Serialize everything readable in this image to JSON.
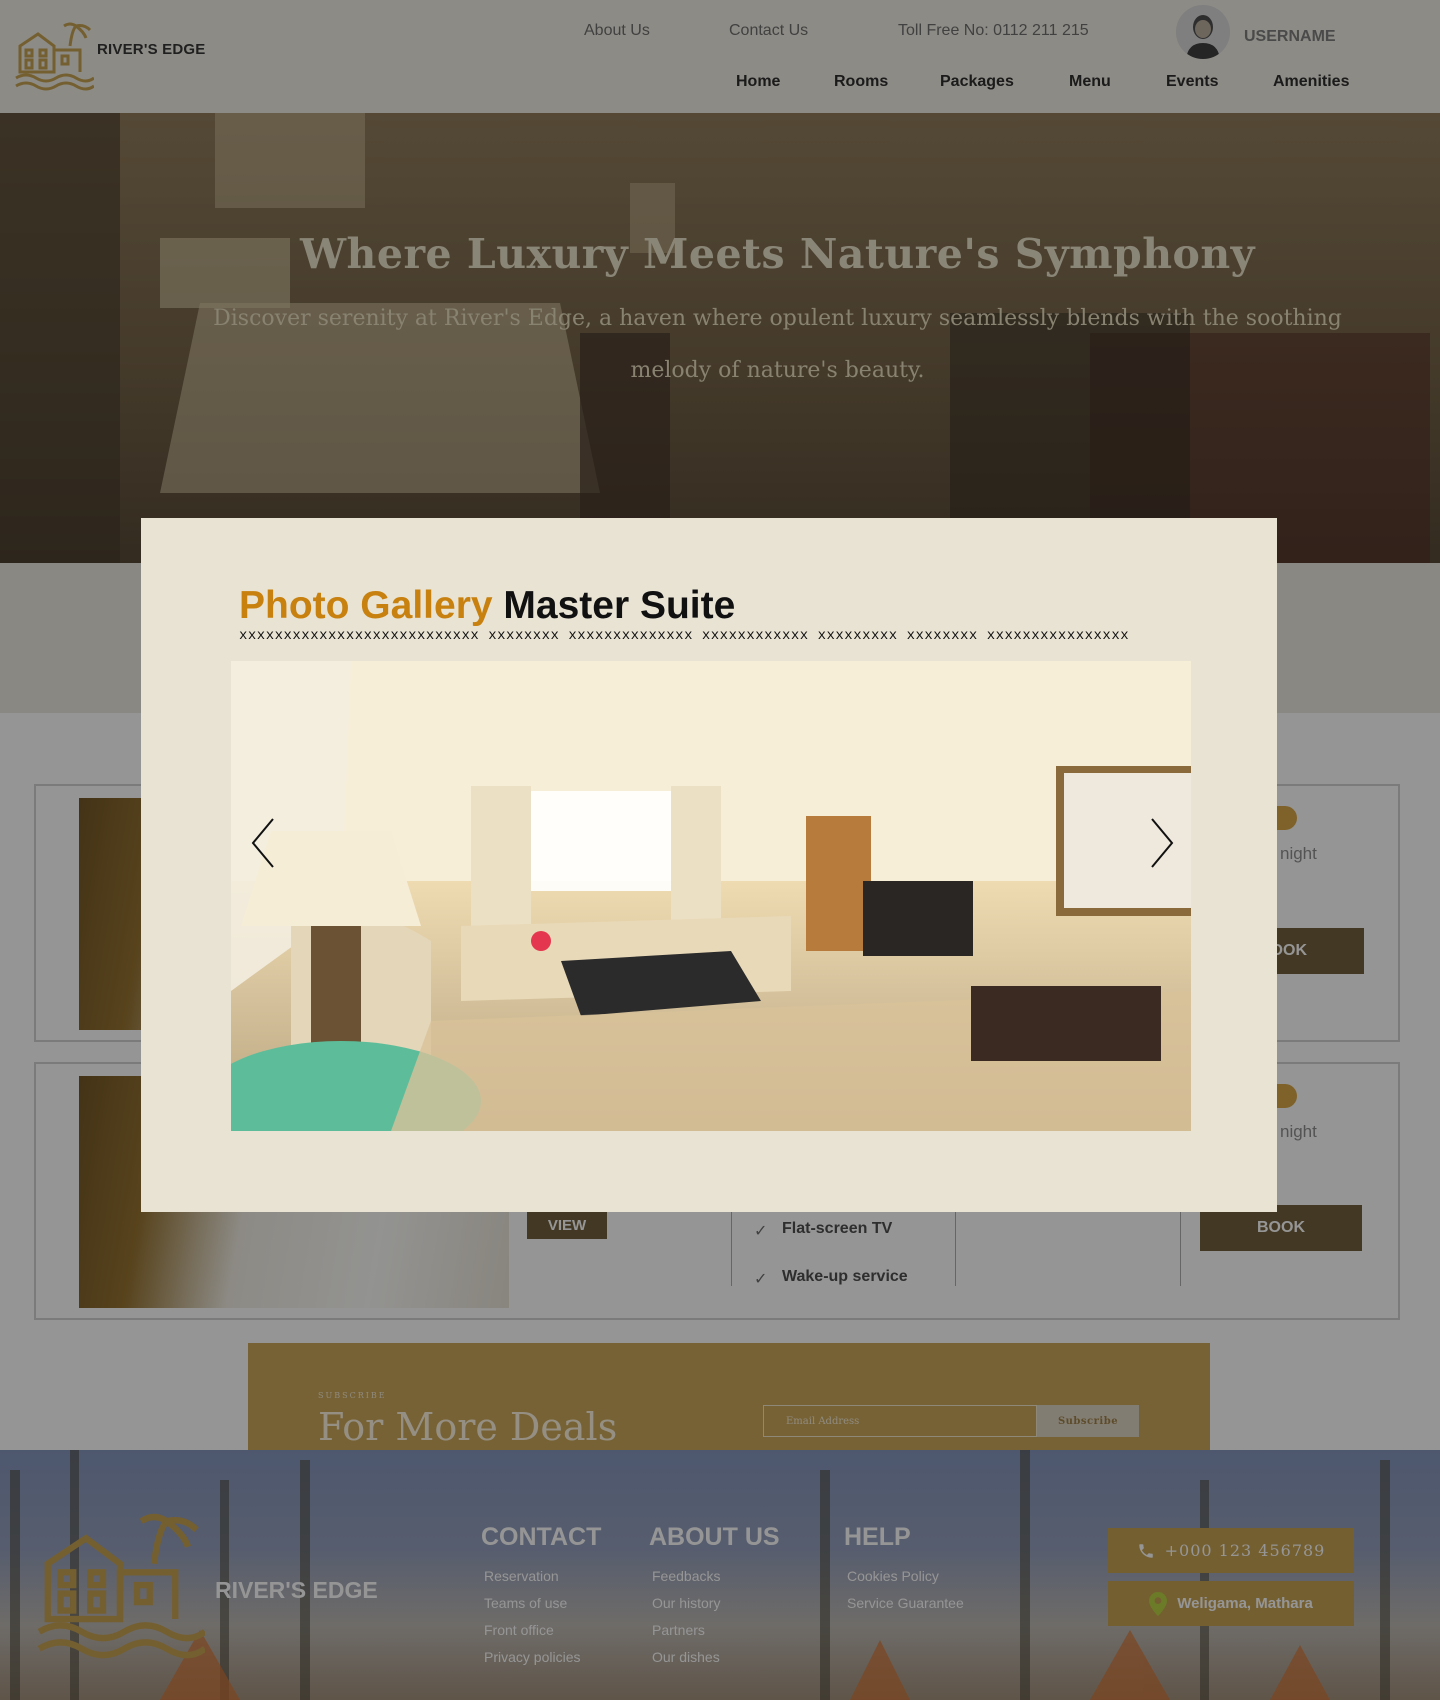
{
  "header": {
    "brand": "RIVER'S EDGE",
    "top_links": [
      "About Us",
      "Contact Us",
      "Toll Free No: 0112 211 215"
    ],
    "nav": [
      "Home",
      "Rooms",
      "Packages",
      "Menu",
      "Events",
      "Amenities"
    ],
    "username": "USERNAME"
  },
  "hero": {
    "title": "Where Luxury Meets Nature's Symphony",
    "subtitle": "Discover serenity at River's Edge, a haven where opulent luxury seamlessly blends with the soothing melody of nature's beauty."
  },
  "rooms": {
    "view_label": "VIEW",
    "book_label": "BOOK",
    "book_partial": "OK",
    "night_label": "night",
    "features": [
      "Flat-screen TV",
      "Wake-up service"
    ]
  },
  "modal": {
    "title_highlight": "Photo Gallery",
    "title_rest": "Master Suite",
    "subtitle": "xxxxxxxxxxxxxxxxxxxxxxxxxxx xxxxxxxx xxxxxxxxxxxxxx xxxxxxxxxxxx xxxxxxxxx xxxxxxxx  xxxxxxxxxxxxxxxx"
  },
  "subscribe": {
    "eyebrow": "SUBSCRIBE",
    "title": "For More Deals",
    "email_placeholder": "Email Address",
    "button": "Subscribe"
  },
  "footer": {
    "brand": "RIVER'S EDGE",
    "columns": [
      {
        "heading": "CONTACT",
        "links": [
          "Reservation",
          "Teams of use",
          "Front office",
          "Privacy policies"
        ]
      },
      {
        "heading": "ABOUT US",
        "links": [
          "Feedbacks",
          "Our history",
          "Partners",
          "Our dishes"
        ]
      },
      {
        "heading": "HELP",
        "links": [
          "Cookies Policy",
          "Service Guarantee"
        ]
      }
    ],
    "phone": "+000 123 456789",
    "location": "Weligama, Mathara"
  },
  "colors": {
    "accent": "#c8810e",
    "brand_gold": "#c49d49",
    "button_dark": "#6a5630"
  }
}
